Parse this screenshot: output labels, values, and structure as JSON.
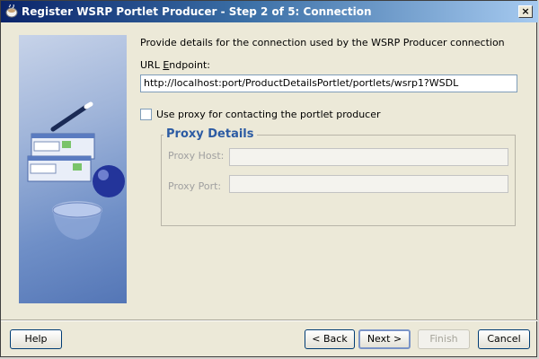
{
  "window": {
    "title": "Register WSRP Portlet Producer - Step 2 of 5: Connection",
    "close_glyph": "×"
  },
  "main": {
    "intro": "Provide details for the connection used by the WSRP Producer connection",
    "url_label_prefix": "URL ",
    "url_label_mnemonic": "E",
    "url_label_suffix": "ndpoint:",
    "url_value": "http://localhost:port/ProductDetailsPortlet/portlets/wsrp1?WSDL",
    "use_proxy_label": "Use proxy for contacting the portlet producer",
    "use_proxy_checked": false
  },
  "proxy": {
    "group_title": "Proxy Details",
    "host_label": "Proxy Host:",
    "port_label": "Proxy Port:",
    "host_value": "",
    "port_value": ""
  },
  "buttons": {
    "help": "Help",
    "back": "< Back",
    "next": "Next >",
    "finish": "Finish",
    "cancel": "Cancel"
  },
  "icons": {
    "title": "oracle-coffee-cup-icon",
    "side": "wizard-illustration"
  },
  "colors": {
    "title_bar_start": "#0a246a",
    "title_bar_end": "#a6caf0",
    "group_title": "#2c5ba3"
  }
}
